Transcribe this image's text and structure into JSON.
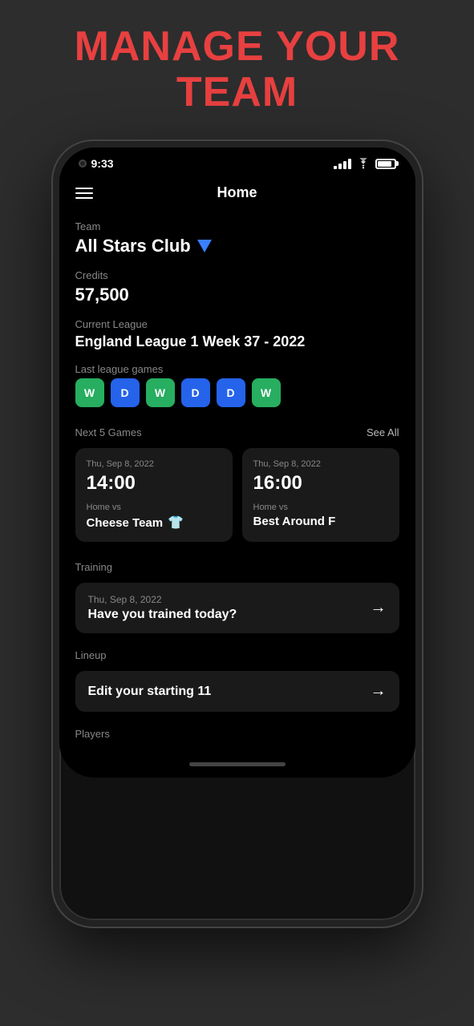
{
  "page": {
    "title_line1": "MANAGE YOUR",
    "title_line2": "TEAM"
  },
  "status_bar": {
    "time": "9:33",
    "battery_level": 85
  },
  "header": {
    "title": "Home"
  },
  "team": {
    "label": "Team",
    "name": "All Stars Club"
  },
  "credits": {
    "label": "Credits",
    "value": "57,500"
  },
  "league": {
    "label": "Current League",
    "name": "England League 1 Week 37 - 2022"
  },
  "last_games": {
    "label": "Last league games",
    "results": [
      {
        "result": "W",
        "type": "w"
      },
      {
        "result": "D",
        "type": "d"
      },
      {
        "result": "W",
        "type": "w"
      },
      {
        "result": "D",
        "type": "d"
      },
      {
        "result": "D",
        "type": "d"
      },
      {
        "result": "W",
        "type": "w"
      }
    ]
  },
  "next_games": {
    "label": "Next 5 Games",
    "see_all": "See All",
    "games": [
      {
        "date": "Thu, Sep 8, 2022",
        "time": "14:00",
        "vs_label": "Home vs",
        "opponent": "Cheese Team",
        "has_jersey": true
      },
      {
        "date": "Thu, Sep 8, 2022",
        "time": "16:00",
        "vs_label": "Home vs",
        "opponent": "Best Around F",
        "has_jersey": false
      }
    ]
  },
  "training": {
    "label": "Training",
    "card": {
      "date": "Thu, Sep 8, 2022",
      "title": "Have you trained today?",
      "arrow": "→"
    }
  },
  "lineup": {
    "label": "Lineup",
    "card": {
      "title": "Edit your starting 11",
      "arrow": "→"
    }
  },
  "players_label": "Players"
}
